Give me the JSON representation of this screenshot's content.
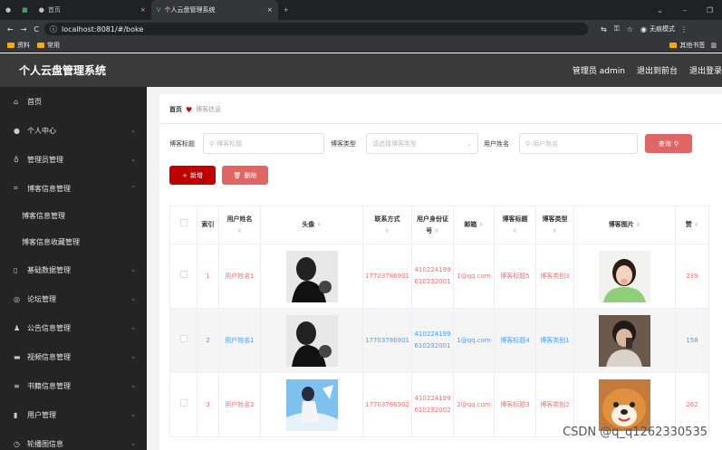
{
  "browser": {
    "tabs": [
      {
        "label": ""
      },
      {
        "label": ""
      },
      {
        "label": "首页"
      },
      {
        "label": "个人云盘管理系统"
      }
    ],
    "url": "localhost:8081/#/boke",
    "profile": "无痕模式",
    "bookmarks": [
      "资料",
      "常用"
    ],
    "other_bookmarks": "其他书签"
  },
  "header": {
    "title": "个人云盘管理系统",
    "user": "管理员 admin",
    "back_frontend": "退出到前台",
    "logout": "退出登录"
  },
  "sidebar": {
    "items": [
      {
        "label": "首页",
        "icon": "home-icon"
      },
      {
        "label": "个人中心",
        "icon": "user-icon"
      },
      {
        "label": "管理员管理",
        "icon": "mic-icon"
      },
      {
        "label": "博客信息管理",
        "icon": "crop-icon"
      },
      {
        "label": "博客信息管理"
      },
      {
        "label": "博客信息收藏管理"
      },
      {
        "label": "基础数据管理",
        "icon": "phone-icon"
      },
      {
        "label": "论坛管理",
        "icon": "compass-icon"
      },
      {
        "label": "公告信息管理",
        "icon": "person-icon"
      },
      {
        "label": "视频信息管理",
        "icon": "monitor-icon"
      },
      {
        "label": "书籍信息管理",
        "icon": "list-icon"
      },
      {
        "label": "用户管理",
        "icon": "chart-icon"
      },
      {
        "label": "轮播图信息",
        "icon": "clock-icon"
      }
    ]
  },
  "breadcrumb": {
    "home": "首页",
    "current": "博客信息"
  },
  "search": {
    "title_label": "博客标题",
    "title_placeholder": "博客标题",
    "type_label": "博客类型",
    "type_placeholder": "请选择博客类型",
    "user_label": "用户姓名",
    "user_placeholder": "用户姓名",
    "query_button": "查询"
  },
  "actions": {
    "add": "新增",
    "delete": "删除"
  },
  "table": {
    "headers": {
      "index": "索引",
      "username": "用户姓名",
      "avatar": "头像",
      "phone": "联系方式",
      "idcard": "用户身份证号",
      "email": "邮箱",
      "blog_title": "博客标题",
      "blog_type": "博客类型",
      "blog_image": "博客图片",
      "likes": "赞"
    },
    "rows": [
      {
        "index": "1",
        "username": "用户姓名1",
        "phone": "17703786901",
        "idcard": "410224199610232001",
        "email": "1@qq.com",
        "blog_title": "博客标题5",
        "blog_type": "博客类别3",
        "likes": "239"
      },
      {
        "index": "2",
        "username": "用户姓名1",
        "phone": "17703786901",
        "idcard": "410224199610232001",
        "email": "1@qq.com",
        "blog_title": "博客标题4",
        "blog_type": "博客类别1",
        "likes": "158"
      },
      {
        "index": "3",
        "username": "用户姓名2",
        "phone": "17703786902",
        "idcard": "410224199610232002",
        "email": "2@qq.com",
        "blog_title": "博客标题3",
        "blog_type": "博客类别2",
        "likes": "262"
      }
    ]
  },
  "watermark": "CSDN @q_q1262330535",
  "colors": {
    "accent_red": "#c00000",
    "link_red": "#f56c6c",
    "link_blue": "#409eff",
    "sidebar_bg": "#242424"
  }
}
